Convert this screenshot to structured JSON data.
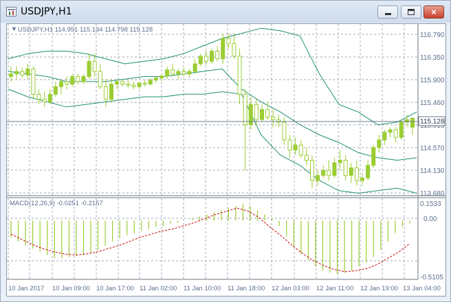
{
  "window": {
    "title": "USDJPY,H1",
    "buttons": {
      "minimize": "minimize",
      "maximize": "maximize",
      "close": "×"
    }
  },
  "colors": {
    "candle": "#9acd32",
    "bands": "#1f8f6f",
    "grid": "#a0a8b0",
    "axis_text": "#5a6e8c",
    "macd_signal": "#cc0000",
    "price_line": "#6b7b8a"
  },
  "main_panel": {
    "info_label": "USDJPY,H1  114.951 115.134 114.798 115.128",
    "price_scale": [
      "116.790",
      "116.350",
      "115.900",
      "115.460",
      "115.015",
      "114.570",
      "114.130",
      "113.680"
    ],
    "current_price_label": "115.128"
  },
  "macd_panel": {
    "info_label": "MACD(12,26,9) -0.0251 -0.2157",
    "scale": [
      "0.1533",
      "0.00",
      "-0.5105"
    ]
  },
  "time_axis": [
    "10 Jan 2017",
    "10 Jan 09:00",
    "10 Jan 17:00",
    "11 Jan 02:00",
    "11 Jan 10:00",
    "11 Jan 18:00",
    "12 Jan 03:00",
    "12 Jan 11:00",
    "12 Jan 19:00",
    "13 Jan 04:00"
  ],
  "chart_data": {
    "type": "candlestick",
    "symbol": "USDJPY",
    "timeframe": "H1",
    "y_range": [
      113.63,
      116.93
    ],
    "candles": [
      {
        "o": 115.95,
        "h": 116.15,
        "l": 115.85,
        "c": 116.0
      },
      {
        "o": 116.0,
        "h": 116.15,
        "l": 115.9,
        "c": 116.05
      },
      {
        "o": 116.05,
        "h": 116.12,
        "l": 115.92,
        "c": 115.98
      },
      {
        "o": 115.98,
        "h": 116.2,
        "l": 115.9,
        "c": 116.1
      },
      {
        "o": 116.1,
        "h": 116.15,
        "l": 115.5,
        "c": 115.6
      },
      {
        "o": 115.6,
        "h": 115.7,
        "l": 115.4,
        "c": 115.5
      },
      {
        "o": 115.5,
        "h": 115.65,
        "l": 115.35,
        "c": 115.45
      },
      {
        "o": 115.45,
        "h": 115.7,
        "l": 115.4,
        "c": 115.6
      },
      {
        "o": 115.6,
        "h": 115.85,
        "l": 115.55,
        "c": 115.75
      },
      {
        "o": 115.75,
        "h": 115.9,
        "l": 115.6,
        "c": 115.85
      },
      {
        "o": 115.85,
        "h": 115.95,
        "l": 115.7,
        "c": 115.8
      },
      {
        "o": 115.8,
        "h": 116.0,
        "l": 115.75,
        "c": 115.95
      },
      {
        "o": 115.95,
        "h": 116.0,
        "l": 115.8,
        "c": 115.85
      },
      {
        "o": 115.85,
        "h": 116.0,
        "l": 115.8,
        "c": 115.95
      },
      {
        "o": 115.95,
        "h": 116.4,
        "l": 115.9,
        "c": 116.25
      },
      {
        "o": 116.25,
        "h": 116.4,
        "l": 115.95,
        "c": 116.05
      },
      {
        "o": 116.05,
        "h": 116.2,
        "l": 115.7,
        "c": 115.75
      },
      {
        "o": 115.75,
        "h": 115.9,
        "l": 115.35,
        "c": 115.5
      },
      {
        "o": 115.5,
        "h": 115.9,
        "l": 115.45,
        "c": 115.8
      },
      {
        "o": 115.8,
        "h": 115.9,
        "l": 115.7,
        "c": 115.85
      },
      {
        "o": 115.85,
        "h": 115.9,
        "l": 115.75,
        "c": 115.8
      },
      {
        "o": 115.8,
        "h": 115.88,
        "l": 115.72,
        "c": 115.78
      },
      {
        "o": 115.78,
        "h": 115.85,
        "l": 115.7,
        "c": 115.75
      },
      {
        "o": 115.75,
        "h": 115.85,
        "l": 115.7,
        "c": 115.82
      },
      {
        "o": 115.82,
        "h": 115.88,
        "l": 115.75,
        "c": 115.8
      },
      {
        "o": 115.8,
        "h": 115.92,
        "l": 115.78,
        "c": 115.88
      },
      {
        "o": 115.88,
        "h": 115.95,
        "l": 115.82,
        "c": 115.92
      },
      {
        "o": 115.92,
        "h": 116.0,
        "l": 115.86,
        "c": 115.96
      },
      {
        "o": 115.96,
        "h": 116.15,
        "l": 115.9,
        "c": 116.08
      },
      {
        "o": 116.08,
        "h": 116.2,
        "l": 115.95,
        "c": 116.0
      },
      {
        "o": 116.0,
        "h": 116.1,
        "l": 115.9,
        "c": 116.05
      },
      {
        "o": 116.05,
        "h": 116.12,
        "l": 115.95,
        "c": 116.0
      },
      {
        "o": 116.0,
        "h": 116.1,
        "l": 115.92,
        "c": 116.05
      },
      {
        "o": 116.05,
        "h": 116.3,
        "l": 116.0,
        "c": 116.2
      },
      {
        "o": 116.2,
        "h": 116.4,
        "l": 116.15,
        "c": 116.35
      },
      {
        "o": 116.35,
        "h": 116.45,
        "l": 116.18,
        "c": 116.25
      },
      {
        "o": 116.25,
        "h": 116.5,
        "l": 116.2,
        "c": 116.45
      },
      {
        "o": 116.45,
        "h": 116.55,
        "l": 116.25,
        "c": 116.3
      },
      {
        "o": 116.3,
        "h": 116.8,
        "l": 116.2,
        "c": 116.7
      },
      {
        "o": 116.7,
        "h": 116.8,
        "l": 116.5,
        "c": 116.6
      },
      {
        "o": 116.6,
        "h": 116.8,
        "l": 116.3,
        "c": 116.35
      },
      {
        "o": 116.35,
        "h": 116.5,
        "l": 115.4,
        "c": 115.6
      },
      {
        "o": 115.6,
        "h": 115.7,
        "l": 114.1,
        "c": 115.0
      },
      {
        "o": 115.0,
        "h": 115.55,
        "l": 114.9,
        "c": 115.4
      },
      {
        "o": 115.4,
        "h": 115.5,
        "l": 115.0,
        "c": 115.1
      },
      {
        "o": 115.1,
        "h": 115.4,
        "l": 115.05,
        "c": 115.3
      },
      {
        "o": 115.3,
        "h": 115.45,
        "l": 115.1,
        "c": 115.15
      },
      {
        "o": 115.15,
        "h": 115.3,
        "l": 114.95,
        "c": 115.1
      },
      {
        "o": 115.1,
        "h": 115.2,
        "l": 114.95,
        "c": 115.05
      },
      {
        "o": 115.05,
        "h": 115.15,
        "l": 114.6,
        "c": 114.7
      },
      {
        "o": 114.7,
        "h": 114.8,
        "l": 114.35,
        "c": 114.5
      },
      {
        "o": 114.5,
        "h": 114.75,
        "l": 114.4,
        "c": 114.6
      },
      {
        "o": 114.6,
        "h": 114.7,
        "l": 114.35,
        "c": 114.4
      },
      {
        "o": 114.4,
        "h": 114.55,
        "l": 114.2,
        "c": 114.3
      },
      {
        "o": 114.3,
        "h": 114.4,
        "l": 113.75,
        "c": 113.9
      },
      {
        "o": 113.9,
        "h": 114.1,
        "l": 113.8,
        "c": 114.0
      },
      {
        "o": 114.0,
        "h": 114.2,
        "l": 113.95,
        "c": 114.1
      },
      {
        "o": 114.1,
        "h": 114.3,
        "l": 113.9,
        "c": 114.0
      },
      {
        "o": 114.0,
        "h": 114.35,
        "l": 113.95,
        "c": 114.25
      },
      {
        "o": 114.25,
        "h": 114.5,
        "l": 114.1,
        "c": 114.3
      },
      {
        "o": 114.3,
        "h": 114.4,
        "l": 113.9,
        "c": 114.0
      },
      {
        "o": 114.0,
        "h": 114.25,
        "l": 113.85,
        "c": 114.15
      },
      {
        "o": 114.15,
        "h": 114.3,
        "l": 113.8,
        "c": 113.9
      },
      {
        "o": 113.9,
        "h": 114.05,
        "l": 113.8,
        "c": 113.95
      },
      {
        "o": 113.95,
        "h": 114.3,
        "l": 113.9,
        "c": 114.2
      },
      {
        "o": 114.2,
        "h": 114.6,
        "l": 114.15,
        "c": 114.55
      },
      {
        "o": 114.55,
        "h": 114.8,
        "l": 114.45,
        "c": 114.7
      },
      {
        "o": 114.7,
        "h": 114.9,
        "l": 114.6,
        "c": 114.85
      },
      {
        "o": 114.85,
        "h": 114.95,
        "l": 114.75,
        "c": 114.9
      },
      {
        "o": 114.9,
        "h": 114.95,
        "l": 114.65,
        "c": 114.75
      },
      {
        "o": 114.75,
        "h": 115.1,
        "l": 114.7,
        "c": 115.05
      },
      {
        "o": 115.05,
        "h": 115.2,
        "l": 114.95,
        "c": 115.1
      },
      {
        "o": 114.95,
        "h": 115.13,
        "l": 114.8,
        "c": 115.13
      }
    ],
    "bollinger": {
      "upper": [
        116.3,
        116.4,
        116.45,
        116.45,
        116.4,
        116.3,
        116.2,
        116.25,
        116.3,
        116.4,
        116.55,
        116.7,
        116.8,
        116.9,
        116.85,
        116.75,
        116.0,
        115.4,
        115.25,
        115.0,
        115.05,
        115.25
      ],
      "middle": [
        116.05,
        116.0,
        115.95,
        115.85,
        115.85,
        115.85,
        115.9,
        115.95,
        115.95,
        116.0,
        116.05,
        116.1,
        115.7,
        115.45,
        115.25,
        115.0,
        114.8,
        114.65,
        114.45,
        114.35,
        114.3,
        114.35
      ],
      "lower": [
        115.7,
        115.55,
        115.45,
        115.35,
        115.4,
        115.45,
        115.5,
        115.55,
        115.55,
        115.6,
        115.6,
        115.65,
        115.6,
        114.8,
        114.4,
        114.2,
        113.9,
        113.7,
        113.65,
        113.7,
        113.75,
        113.65
      ]
    },
    "macd": {
      "info": "MACD(12,26,9)",
      "range": [
        -0.55,
        0.2
      ],
      "histogram": [
        -0.16,
        -0.2,
        -0.24,
        -0.27,
        -0.3,
        -0.33,
        -0.36,
        -0.36,
        -0.35,
        -0.34,
        -0.33,
        -0.31,
        -0.28,
        -0.24,
        -0.2,
        -0.17,
        -0.14,
        -0.12,
        -0.1,
        -0.08,
        -0.06,
        -0.05,
        -0.03,
        -0.02,
        0.0,
        0.02,
        0.04,
        0.06,
        0.08,
        0.1,
        0.12,
        0.14,
        0.16,
        0.14,
        0.1,
        0.06,
        0.02,
        -0.05,
        -0.15,
        -0.25,
        -0.32,
        -0.38,
        -0.44,
        -0.48,
        -0.5,
        -0.51,
        -0.5,
        -0.48,
        -0.44,
        -0.4,
        -0.35,
        -0.28,
        -0.2,
        -0.12,
        -0.06,
        -0.03
      ],
      "signal": [
        -0.13,
        -0.18,
        -0.23,
        -0.27,
        -0.3,
        -0.32,
        -0.33,
        -0.32,
        -0.3,
        -0.27,
        -0.24,
        -0.2,
        -0.16,
        -0.13,
        -0.1,
        -0.08,
        -0.05,
        -0.02,
        0.02,
        0.06,
        0.09,
        0.12,
        0.09,
        0.03,
        -0.06,
        -0.14,
        -0.23,
        -0.31,
        -0.38,
        -0.43,
        -0.47,
        -0.49,
        -0.48,
        -0.46,
        -0.42,
        -0.36,
        -0.3,
        -0.22
      ],
      "current": [
        -0.0251,
        -0.2157
      ]
    }
  }
}
